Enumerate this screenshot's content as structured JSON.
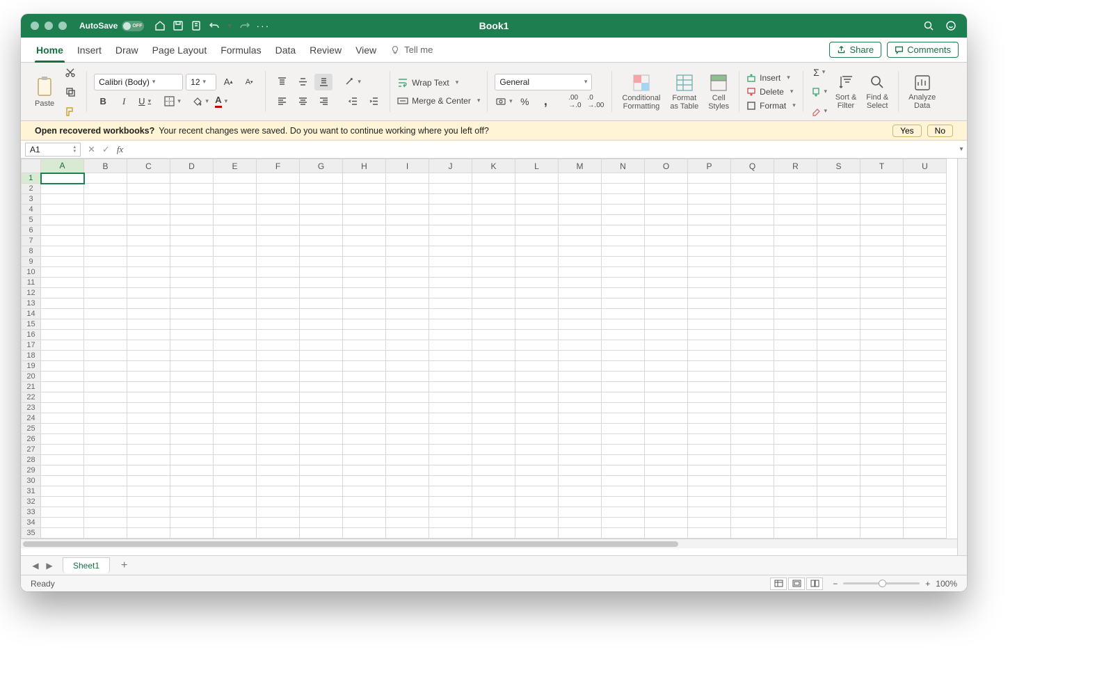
{
  "titlebar": {
    "autosave_label": "AutoSave",
    "autosave_state": "OFF",
    "doc_title": "Book1"
  },
  "tabs": {
    "items": [
      "Home",
      "Insert",
      "Draw",
      "Page Layout",
      "Formulas",
      "Data",
      "Review",
      "View"
    ],
    "active": "Home",
    "tellme": "Tell me",
    "share": "Share",
    "comments": "Comments"
  },
  "ribbon": {
    "paste": "Paste",
    "font_name": "Calibri (Body)",
    "font_size": "12",
    "wrap_text": "Wrap Text",
    "merge_center": "Merge & Center",
    "number_format": "General",
    "cond_fmt": "Conditional\nFormatting",
    "fmt_table": "Format\nas Table",
    "cell_styles": "Cell\nStyles",
    "insert": "Insert",
    "delete": "Delete",
    "format": "Format",
    "sort_filter": "Sort &\nFilter",
    "find_select": "Find &\nSelect",
    "analyze": "Analyze\nData"
  },
  "messagebar": {
    "title": "Open recovered workbooks?",
    "body": "Your recent changes were saved. Do you want to continue working where you left off?",
    "yes": "Yes",
    "no": "No"
  },
  "formula_bar": {
    "name_box": "A1",
    "fx": "fx",
    "value": ""
  },
  "grid": {
    "columns": [
      "A",
      "B",
      "C",
      "D",
      "E",
      "F",
      "G",
      "H",
      "I",
      "J",
      "K",
      "L",
      "M",
      "N",
      "O",
      "P",
      "Q",
      "R",
      "S",
      "T",
      "U"
    ],
    "rows": 35,
    "selected_cell": "A1"
  },
  "sheettabs": {
    "active": "Sheet1"
  },
  "statusbar": {
    "label": "Ready",
    "zoom": "100%"
  }
}
